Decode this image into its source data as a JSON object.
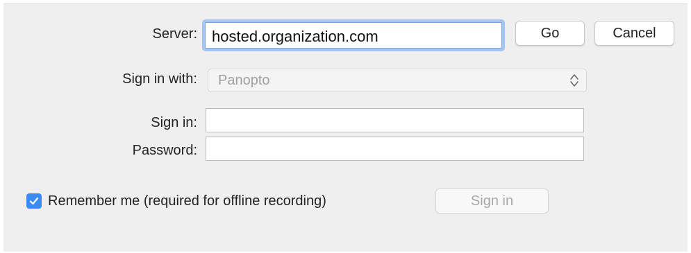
{
  "server": {
    "label": "Server:",
    "value": "hosted.organization.com",
    "go_label": "Go",
    "cancel_label": "Cancel"
  },
  "sign_in_with": {
    "label": "Sign in with:",
    "selected": "Panopto"
  },
  "credentials": {
    "username_label": "Sign in:",
    "username_value": "",
    "password_label": "Password:",
    "password_value": ""
  },
  "remember": {
    "label": "Remember me (required for offline recording)",
    "checked": true
  },
  "sign_in_button": {
    "label": "Sign in"
  },
  "icons": {
    "checkbox": "checkmark-icon",
    "select": "up-down-chevron-icon"
  },
  "colors": {
    "accent": "#3b8bf5",
    "focus_ring": "#a5c5ee",
    "background": "#efefef"
  }
}
